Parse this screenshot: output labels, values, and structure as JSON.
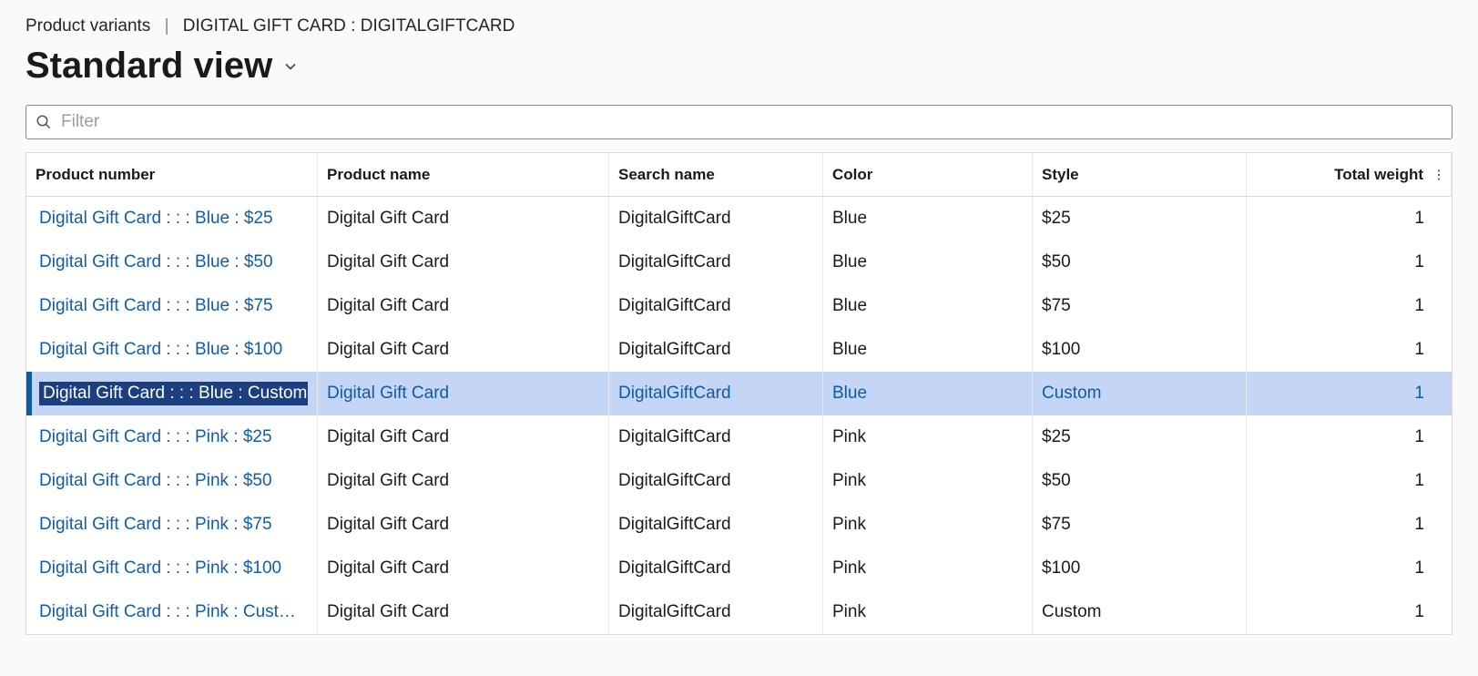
{
  "breadcrumb": {
    "section": "Product variants",
    "detail": "DIGITAL GIFT CARD : DIGITALGIFTCARD"
  },
  "view": {
    "title": "Standard view"
  },
  "filter": {
    "placeholder": "Filter",
    "value": ""
  },
  "columns": {
    "product_number": "Product number",
    "product_name": "Product name",
    "search_name": "Search name",
    "color": "Color",
    "style": "Style",
    "total_weight": "Total weight"
  },
  "rows": [
    {
      "product_number": "Digital Gift Card :  :  : Blue : $25",
      "product_name": "Digital Gift Card",
      "search_name": "DigitalGiftCard",
      "color": "Blue",
      "style": "$25",
      "total_weight": "1",
      "selected": false
    },
    {
      "product_number": "Digital Gift Card :  :  : Blue : $50",
      "product_name": "Digital Gift Card",
      "search_name": "DigitalGiftCard",
      "color": "Blue",
      "style": "$50",
      "total_weight": "1",
      "selected": false
    },
    {
      "product_number": "Digital Gift Card :  :  : Blue : $75",
      "product_name": "Digital Gift Card",
      "search_name": "DigitalGiftCard",
      "color": "Blue",
      "style": "$75",
      "total_weight": "1",
      "selected": false
    },
    {
      "product_number": "Digital Gift Card :  :  : Blue : $100",
      "product_name": "Digital Gift Card",
      "search_name": "DigitalGiftCard",
      "color": "Blue",
      "style": "$100",
      "total_weight": "1",
      "selected": false
    },
    {
      "product_number": "Digital Gift Card :  :  : Blue : Custom",
      "product_name": "Digital Gift Card",
      "search_name": "DigitalGiftCard",
      "color": "Blue",
      "style": "Custom",
      "total_weight": "1",
      "selected": true
    },
    {
      "product_number": "Digital Gift Card :  :  : Pink : $25",
      "product_name": "Digital Gift Card",
      "search_name": "DigitalGiftCard",
      "color": "Pink",
      "style": "$25",
      "total_weight": "1",
      "selected": false
    },
    {
      "product_number": "Digital Gift Card :  :  : Pink : $50",
      "product_name": "Digital Gift Card",
      "search_name": "DigitalGiftCard",
      "color": "Pink",
      "style": "$50",
      "total_weight": "1",
      "selected": false
    },
    {
      "product_number": "Digital Gift Card :  :  : Pink : $75",
      "product_name": "Digital Gift Card",
      "search_name": "DigitalGiftCard",
      "color": "Pink",
      "style": "$75",
      "total_weight": "1",
      "selected": false
    },
    {
      "product_number": "Digital Gift Card :  :  : Pink : $100",
      "product_name": "Digital Gift Card",
      "search_name": "DigitalGiftCard",
      "color": "Pink",
      "style": "$100",
      "total_weight": "1",
      "selected": false
    },
    {
      "product_number": "Digital Gift Card :  :  : Pink : Cust…",
      "product_name": "Digital Gift Card",
      "search_name": "DigitalGiftCard",
      "color": "Pink",
      "style": "Custom",
      "total_weight": "1",
      "selected": false
    }
  ]
}
